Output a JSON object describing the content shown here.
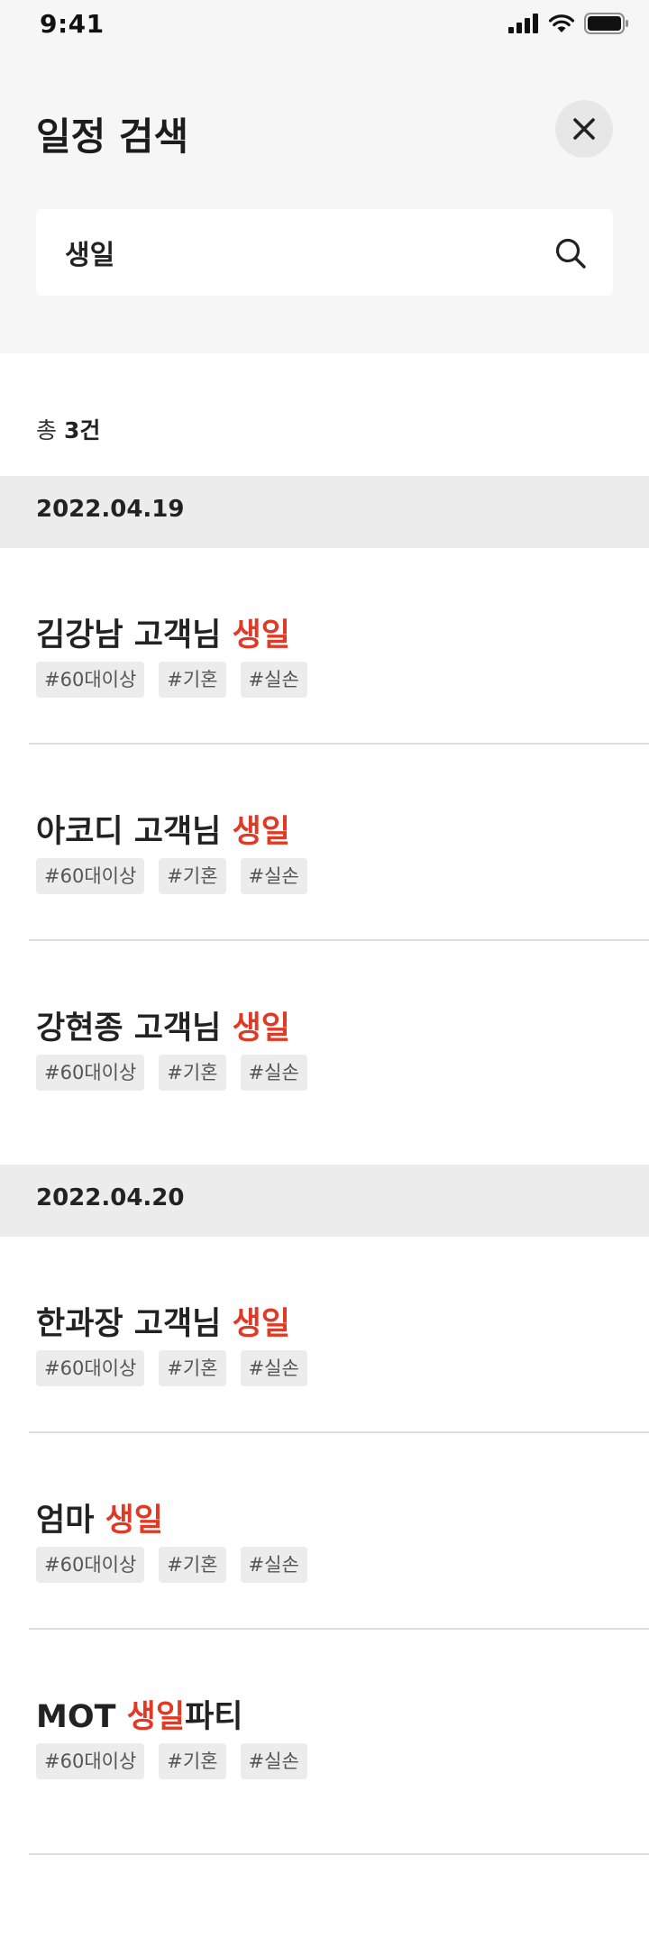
{
  "status_bar": {
    "time": "9:41"
  },
  "header": {
    "title": "일정 검색"
  },
  "search": {
    "query": "생일"
  },
  "results": {
    "count_prefix": "총",
    "count_value": "3건"
  },
  "groups": [
    {
      "date": "2022.04.19",
      "events": [
        {
          "title_before": "김강남 고객님 ",
          "highlight": "생일",
          "title_after": "",
          "tags": [
            "#60대이상",
            "#기혼",
            "#실손"
          ]
        },
        {
          "title_before": "아코디 고객님 ",
          "highlight": "생일",
          "title_after": "",
          "tags": [
            "#60대이상",
            "#기혼",
            "#실손"
          ]
        },
        {
          "title_before": "강현종 고객님 ",
          "highlight": "생일",
          "title_after": "",
          "tags": [
            "#60대이상",
            "#기혼",
            "#실손"
          ]
        }
      ]
    },
    {
      "date": "2022.04.20",
      "events": [
        {
          "title_before": "한과장 고객님 ",
          "highlight": "생일",
          "title_after": "",
          "tags": [
            "#60대이상",
            "#기혼",
            "#실손"
          ]
        },
        {
          "title_before": "엄마 ",
          "highlight": "생일",
          "title_after": "",
          "tags": [
            "#60대이상",
            "#기혼",
            "#실손"
          ]
        },
        {
          "title_before": "MOT ",
          "highlight": "생일",
          "title_after": "파티",
          "tags": [
            "#60대이상",
            "#기혼",
            "#실손"
          ]
        }
      ]
    }
  ],
  "colors": {
    "highlight": "#e03a26",
    "top_background": "#f6f6f6",
    "date_band": "#ececec"
  },
  "icons": [
    "signal-icon",
    "wifi-icon",
    "battery-icon",
    "close-icon",
    "search-icon"
  ]
}
